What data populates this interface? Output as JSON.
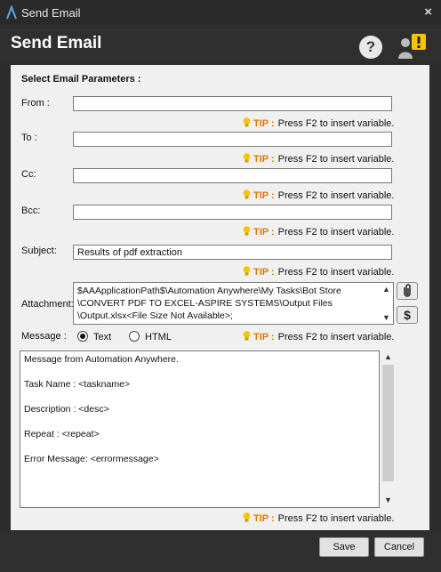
{
  "window": {
    "title": "Send Email",
    "close_glyph": "×"
  },
  "header": {
    "title": "Send Email",
    "help_icon": "help-icon",
    "user_icon": "user-alert-icon"
  },
  "form": {
    "section_title": "Select Email Parameters :",
    "from": {
      "label": "From :",
      "value": ""
    },
    "to": {
      "label": "To :",
      "value": ""
    },
    "cc": {
      "label": "Cc:",
      "value": ""
    },
    "bcc": {
      "label": "Bcc:",
      "value": ""
    },
    "subject": {
      "label": "Subject:",
      "value": "Results of pdf extraction"
    },
    "attachment": {
      "label": "Attachment:",
      "lines": [
        "$AAApplicationPath$\\Automation Anywhere\\My Tasks\\Bot Store",
        "\\CONVERT PDF TO EXCEL-ASPIRE SYSTEMS\\Output Files",
        "\\Output.xlsx<File Size Not Available>;"
      ]
    },
    "message": {
      "label": "Message :",
      "format_text": "Text",
      "format_html": "HTML",
      "selected": "Text",
      "body": [
        "Message from Automation Anywhere.",
        "Task Name : <taskname>",
        "Description : <desc>",
        "Repeat : <repeat>",
        "Error Message: <errormessage>"
      ]
    },
    "tip": {
      "word": "TIP :",
      "text": "Press F2 to insert variable."
    }
  },
  "buttons": {
    "save": "Save",
    "cancel": "Cancel"
  },
  "colors": {
    "tip_accent": "#e07a00",
    "bulb": "#f5c400",
    "alert": "#f5c400"
  }
}
